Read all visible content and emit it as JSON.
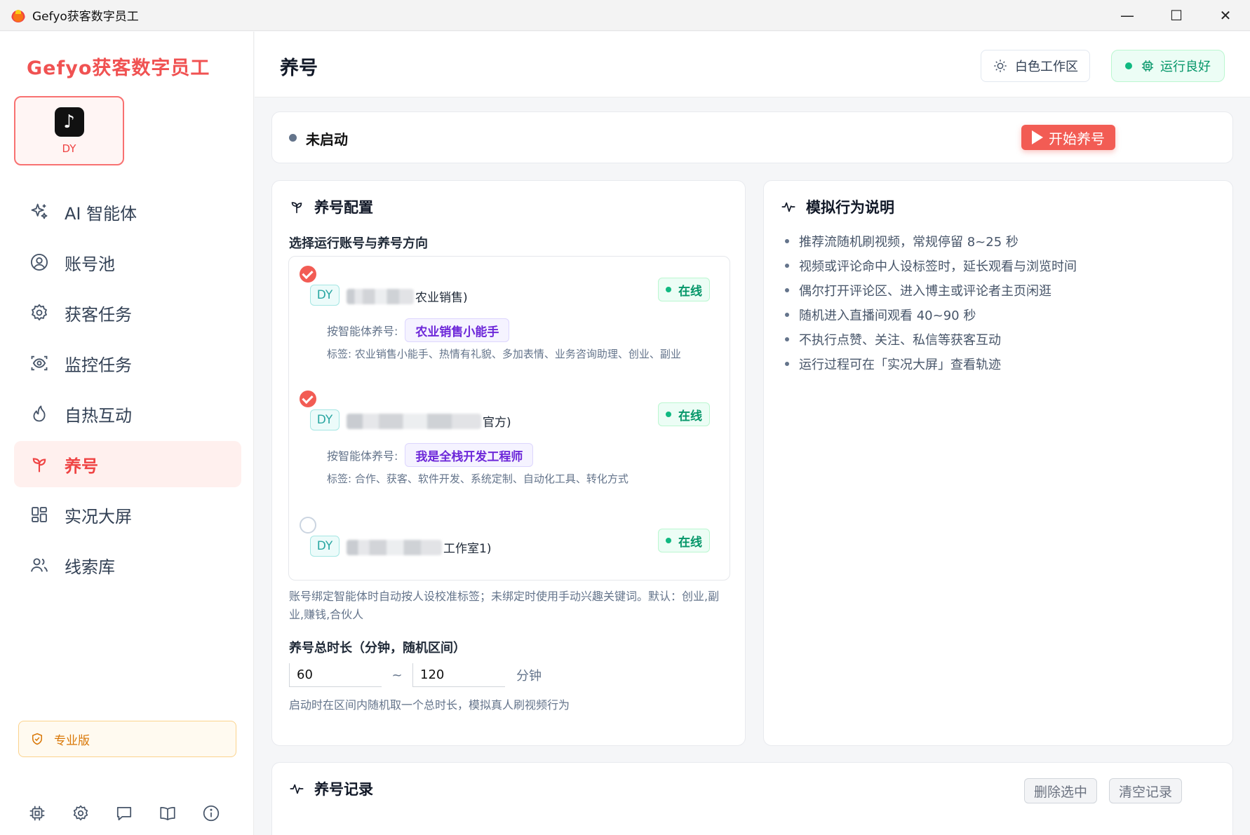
{
  "window": {
    "title": "Gefyo获客数字员工",
    "minimize": "—",
    "maximize": "☐",
    "close": "✕"
  },
  "sidebar": {
    "brand": "Gefyo获客数字员工",
    "account_card_label": "DY",
    "nav": [
      {
        "label": "AI 智能体",
        "icon": "sparkles-icon"
      },
      {
        "label": "账号池",
        "icon": "user-circle-icon"
      },
      {
        "label": "获客任务",
        "icon": "gear-icon"
      },
      {
        "label": "监控任务",
        "icon": "scan-eye-icon"
      },
      {
        "label": "自热互动",
        "icon": "flame-icon"
      },
      {
        "label": "养号",
        "icon": "sprout-icon",
        "active": true
      },
      {
        "label": "实况大屏",
        "icon": "dashboard-grid-icon"
      },
      {
        "label": "线索库",
        "icon": "users-icon"
      }
    ],
    "edition": "专业版",
    "bottom_icons": [
      "cpu-icon",
      "settings-icon",
      "message-icon",
      "book-icon",
      "info-icon"
    ]
  },
  "header": {
    "title": "养号",
    "theme_button": "白色工作区",
    "status_button": "运行良好"
  },
  "status_bar": {
    "state": "未启动",
    "start_button": "开始养号"
  },
  "config": {
    "title": "养号配置",
    "subtitle": "选择运行账号与养号方向",
    "accounts": [
      {
        "checked": true,
        "platform": "DY",
        "name_suffix": "农业销售)",
        "status": "在线",
        "agent_label": "按智能体养号:",
        "agent": "农业销售小能手",
        "tags": "标签: 农业销售小能手、热情有礼貌、多加表情、业务咨询助理、创业、副业"
      },
      {
        "checked": true,
        "platform": "DY",
        "name_suffix": "官方)",
        "status": "在线",
        "agent_label": "按智能体养号:",
        "agent": "我是全栈开发工程师",
        "tags": "标签: 合作、获客、软件开发、系统定制、自动化工具、转化方式"
      },
      {
        "checked": false,
        "platform": "DY",
        "name_suffix": "工作室1)",
        "status": "在线"
      }
    ],
    "hint": "账号绑定智能体时自动按人设校准标签；未绑定时使用手动兴趣关键词。默认：创业,副业,赚钱,合伙人",
    "duration_title": "养号总时长（分钟，随机区间）",
    "duration_min": "60",
    "duration_sep": "~",
    "duration_max": "120",
    "duration_unit": "分钟",
    "duration_hint": "启动时在区间内随机取一个总时长，模拟真人刷视频行为"
  },
  "behavior": {
    "title": "模拟行为说明",
    "items": [
      "推荐流随机刷视频，常规停留 8~25 秒",
      "视频或评论命中人设标签时，延长观看与浏览时间",
      "偶尔打开评论区、进入博主或评论者主页闲逛",
      "随机进入直播间观看 40~90 秒",
      "不执行点赞、关注、私信等获客互动",
      "运行过程可在「实况大屏」查看轨迹"
    ]
  },
  "records": {
    "title": "养号记录",
    "delete_selected": "删除选中",
    "clear_records": "清空记录"
  },
  "colors": {
    "accent": "#f25c54",
    "success": "#10b981",
    "platform_tag": "#2aa7a2",
    "agent_chip": "#6d28d9"
  }
}
